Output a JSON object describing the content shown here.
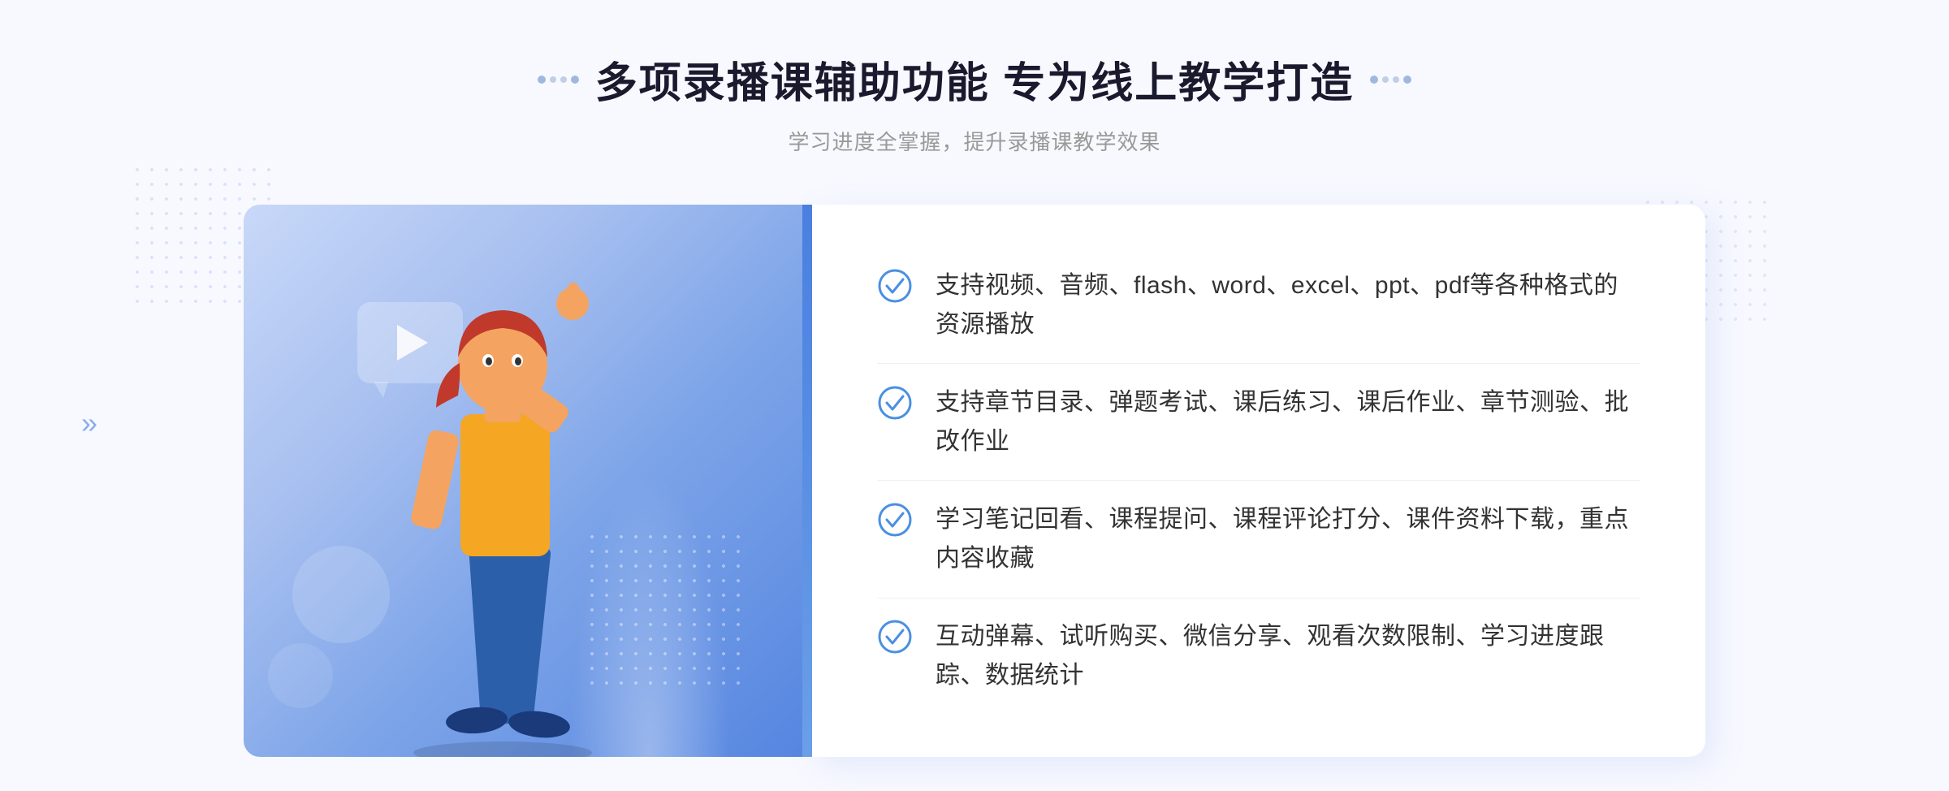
{
  "header": {
    "title": "多项录播课辅助功能 专为线上教学打造",
    "subtitle": "学习进度全掌握，提升录播课教学效果",
    "title_deco_left": "decorative-dots",
    "title_deco_right": "decorative-dots"
  },
  "features": [
    {
      "id": 1,
      "text": "支持视频、音频、flash、word、excel、ppt、pdf等各种格式的资源播放"
    },
    {
      "id": 2,
      "text": "支持章节目录、弹题考试、课后练习、课后作业、章节测验、批改作业"
    },
    {
      "id": 3,
      "text": "学习笔记回看、课程提问、课程评论打分、课件资料下载，重点内容收藏"
    },
    {
      "id": 4,
      "text": "互动弹幕、试听购买、微信分享、观看次数限制、学习进度跟踪、数据统计"
    }
  ],
  "colors": {
    "accent_blue": "#4a90e2",
    "title_color": "#1a1a2e",
    "text_color": "#333333",
    "subtitle_color": "#999999",
    "bg_gradient_start": "#c8d8f8",
    "bg_gradient_end": "#5585e0"
  },
  "icons": {
    "check": "check-circle-icon",
    "play": "play-icon",
    "chevron": "chevron-double-right-icon"
  }
}
